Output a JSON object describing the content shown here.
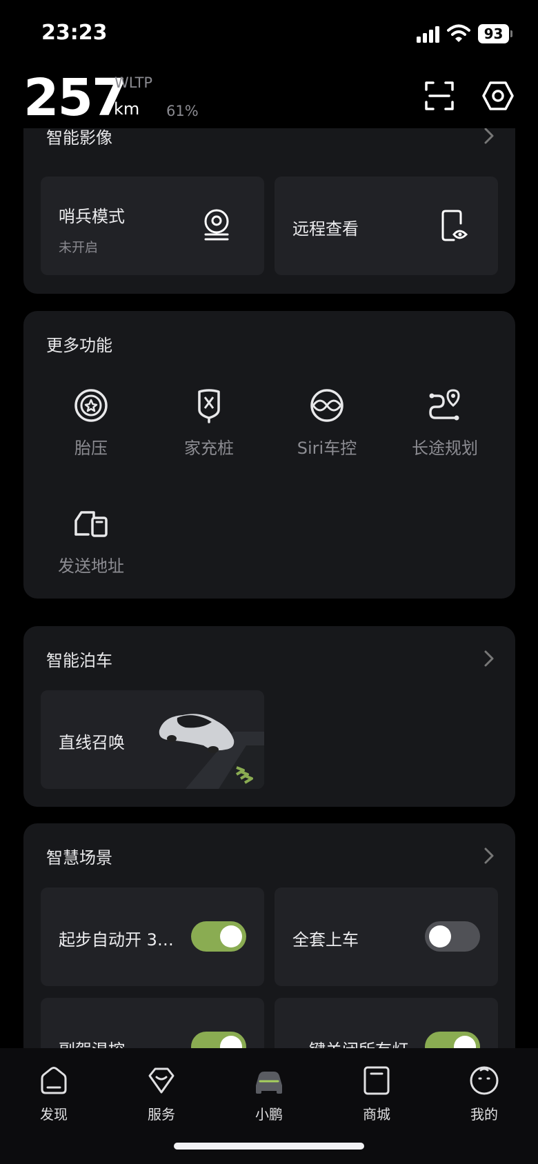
{
  "status_bar": {
    "time": "23:23",
    "battery": "93"
  },
  "header": {
    "range": "257",
    "standard": "WLTP",
    "unit": "km",
    "battery_percent": "61%"
  },
  "smart_camera": {
    "title": "智能影像",
    "tiles": [
      {
        "label": "哨兵模式",
        "sub": "未开启",
        "icon": "sentry-camera-icon"
      },
      {
        "label": "远程查看",
        "icon": "phone-eye-icon"
      }
    ]
  },
  "more_functions": {
    "title": "更多功能",
    "items": [
      {
        "label": "胎压",
        "icon": "tire-icon"
      },
      {
        "label": "家充桩",
        "icon": "charger-icon"
      },
      {
        "label": "Siri车控",
        "icon": "siri-icon"
      },
      {
        "label": "长途规划",
        "icon": "route-icon"
      },
      {
        "label": "发送地址",
        "icon": "send-address-icon"
      }
    ]
  },
  "smart_parking": {
    "title": "智能泊车",
    "tiles": [
      {
        "label": "直线召唤",
        "image": "car-illustration"
      }
    ]
  },
  "smart_scenes": {
    "title": "智慧场景",
    "items": [
      {
        "label": "起步自动开 3…",
        "enabled": true
      },
      {
        "label": "全套上车",
        "enabled": false
      },
      {
        "label": "副驾温控",
        "enabled": true
      },
      {
        "label": "一键关闭所有灯",
        "enabled": true
      }
    ]
  },
  "tab_bar": {
    "tabs": [
      {
        "label": "发现",
        "icon": "discover-icon"
      },
      {
        "label": "服务",
        "icon": "service-icon"
      },
      {
        "label": "小鹏",
        "icon": "car-icon",
        "active": true
      },
      {
        "label": "商城",
        "icon": "shop-icon"
      },
      {
        "label": "我的",
        "icon": "profile-icon"
      }
    ]
  },
  "colors": {
    "toggle_on": "#8aac52",
    "background": "#000000",
    "card": "#17181b",
    "tile": "#212226"
  }
}
